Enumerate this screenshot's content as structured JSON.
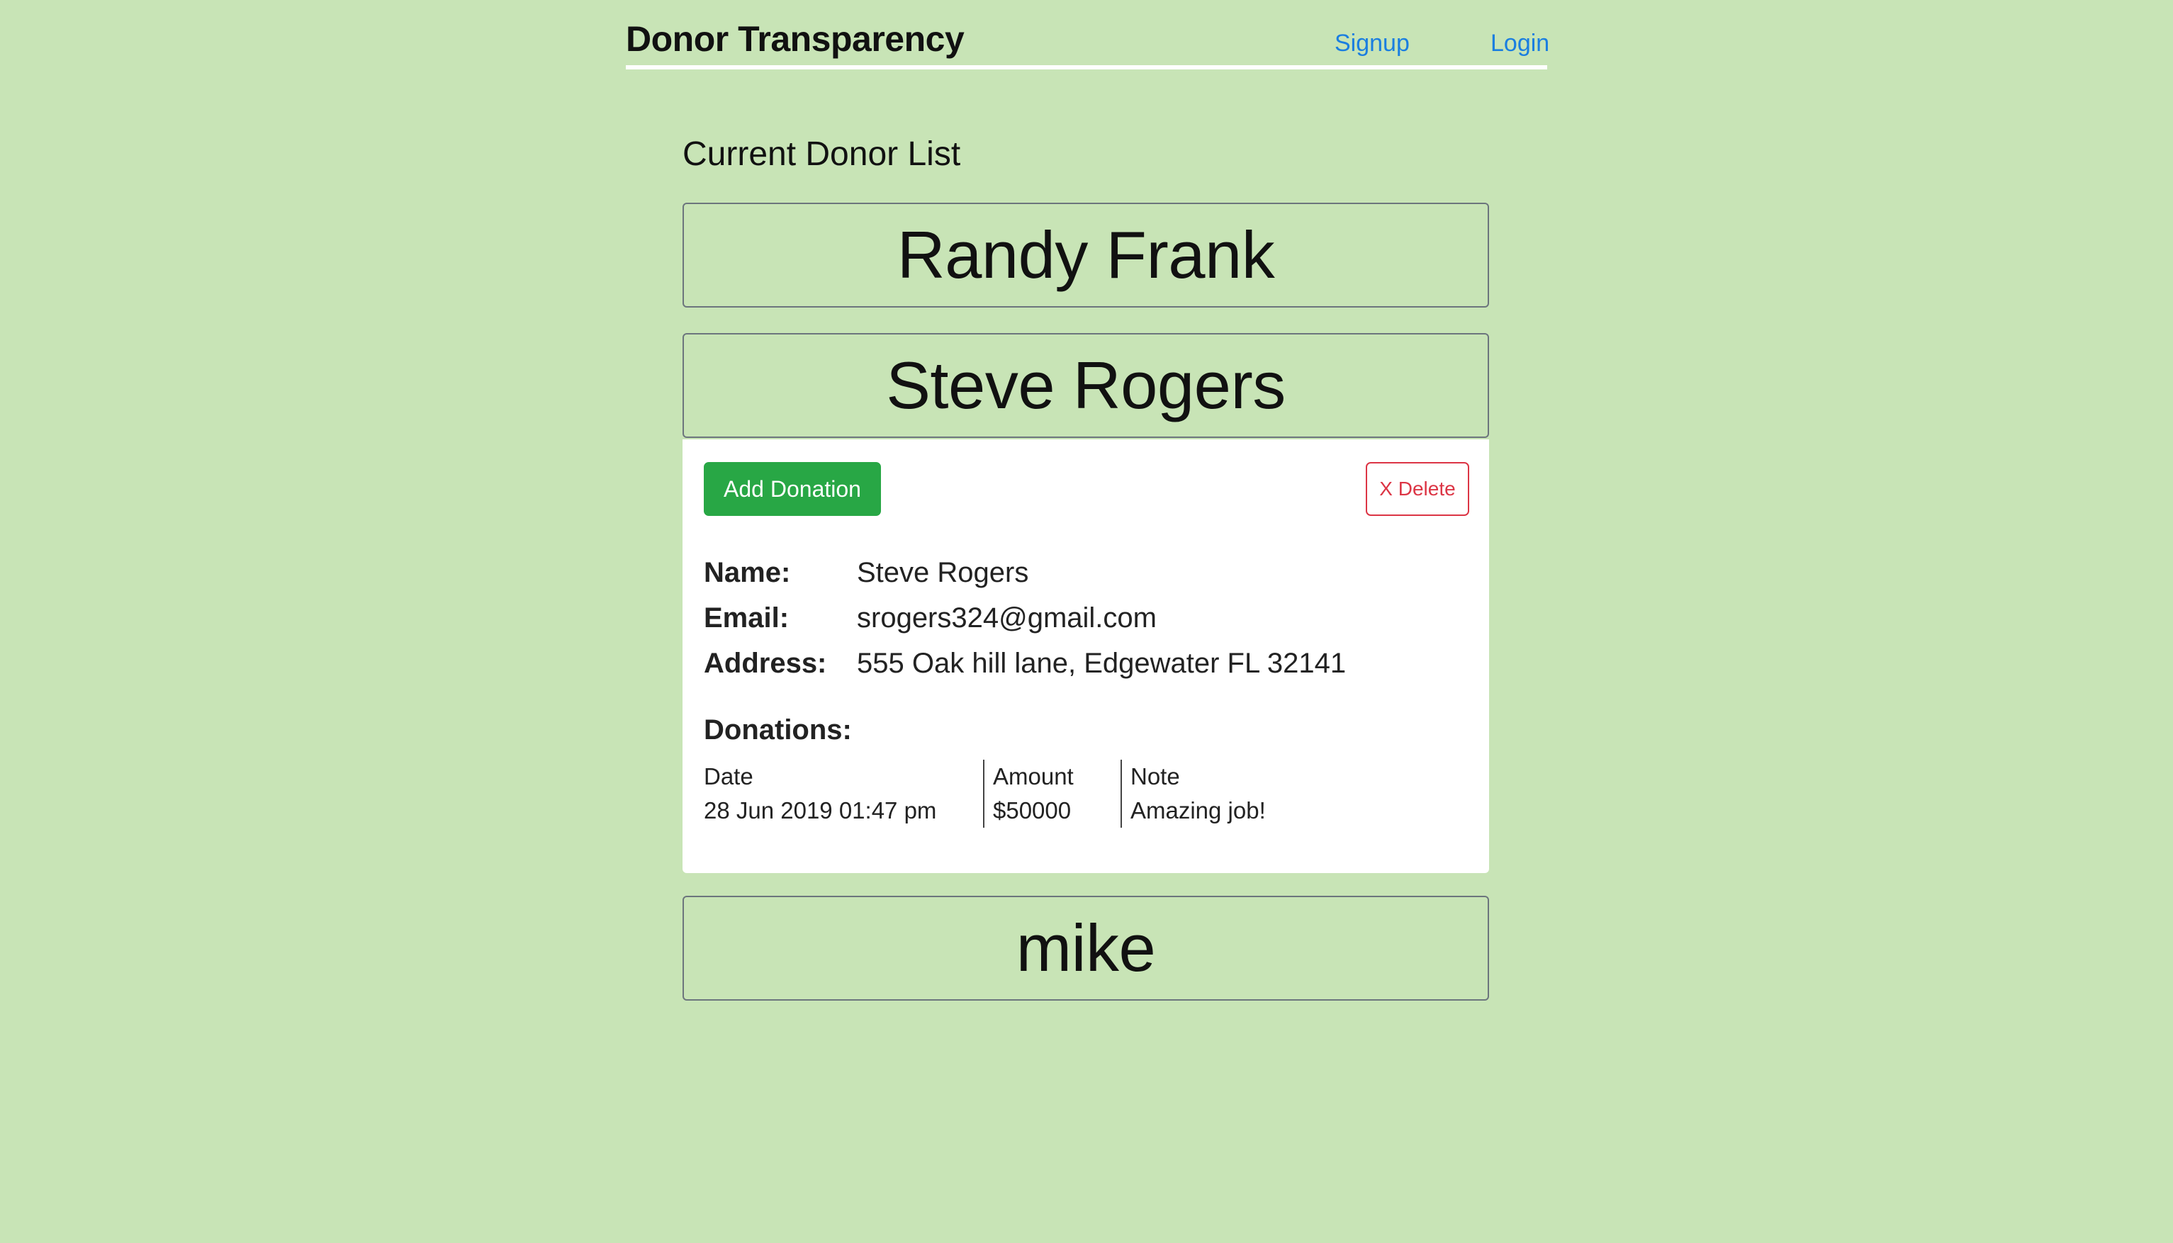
{
  "header": {
    "brand": "Donor Transparency",
    "signup_label": "Signup",
    "login_label": "Login"
  },
  "main": {
    "list_title": "Current Donor List",
    "donors": [
      {
        "name": "Randy Frank"
      },
      {
        "name": "Steve Rogers"
      },
      {
        "name": "mike"
      }
    ],
    "selected_donor": {
      "add_donation_label": "Add Donation",
      "delete_label": "X Delete",
      "fields": {
        "name_label": "Name:",
        "name_value": "Steve Rogers",
        "email_label": "Email:",
        "email_value": "srogers324@gmail.com",
        "address_label": "Address:",
        "address_value": "555 Oak hill lane, Edgewater FL 32141"
      },
      "donations_heading": "Donations:",
      "donations_columns": [
        "Date",
        "Amount",
        "Note"
      ],
      "donations": [
        {
          "date": "28 Jun 2019 01:47 pm",
          "amount": "$50000",
          "note": "Amazing job!"
        }
      ]
    }
  },
  "colors": {
    "background": "#c8e4b6",
    "link": "#1a7ee0",
    "add_button": "#28a745",
    "delete_button": "#dc3545"
  }
}
